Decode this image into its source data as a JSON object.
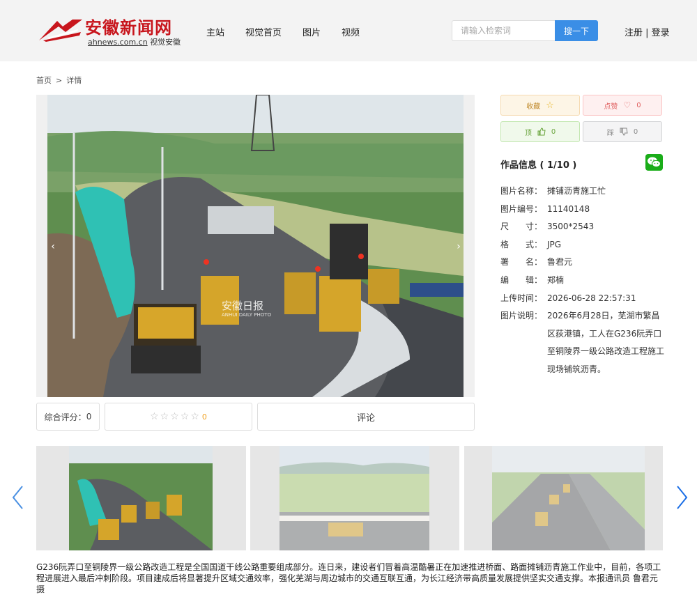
{
  "header": {
    "logo_cn": "安徽新闻网",
    "logo_en": "ahnews.com.cn",
    "logo_sub": "视觉安徽",
    "nav": [
      "主站",
      "视觉首页",
      "图片",
      "视频"
    ],
    "search": {
      "placeholder": "请输入检索词",
      "button": "搜一下"
    },
    "register": "注册",
    "login": "登录",
    "auth_sep": " | "
  },
  "breadcrumb": {
    "home": "首页",
    "sep": ">",
    "current": "详情"
  },
  "photo": {
    "watermark": "安徽日报",
    "watermark_en": "ANHUI DAILY PHOTO"
  },
  "rating": {
    "label": "综合评分：",
    "score": "0",
    "stars_count": "0",
    "comment": "评论"
  },
  "actions": {
    "favorite": "收藏",
    "like": "点赞",
    "like_count": "0",
    "up": "顶",
    "up_count": "0",
    "down": "踩",
    "down_count": "0"
  },
  "info": {
    "title": "作品信息 ( 1/10 )",
    "rows": [
      {
        "label": "图片名称：",
        "value": "摊铺沥青施工忙"
      },
      {
        "label": "图片编号：",
        "value": "11140148"
      },
      {
        "label": "尺　　寸：",
        "value": "3500*2543"
      },
      {
        "label": "格　　式：",
        "value": "JPG"
      },
      {
        "label": "署　　名：",
        "value": "鲁君元"
      },
      {
        "label": "编　　辑：",
        "value": "郑楠"
      },
      {
        "label": "上传时间：",
        "value": "2026-06-28 22:57:31"
      },
      {
        "label": "图片说明：",
        "value": "2026年6月28日，芜湖市繁昌区荻港镇，工人在G236阮弄口至铜陵界一级公路改造工程施工现场铺筑沥青。"
      }
    ]
  },
  "caption": "G236阮弄口至铜陵界一级公路改造工程是全国国道干线公路重要组成部分。连日来，建设者们冒着高温酷暑正在加速推进桥面、路面摊铺沥青施工作业中，目前，各项工程进展进入最后冲刺阶段。项目建成后将显著提升区域交通效率，强化芜湖与周边城市的交通互联互通，为长江经济带高质量发展提供坚实交通支撑。本报通讯员 鲁君元 摄",
  "colors": {
    "brand_red": "#c8161d",
    "search_blue": "#3a8ee6",
    "wechat_green": "#1aad19"
  }
}
